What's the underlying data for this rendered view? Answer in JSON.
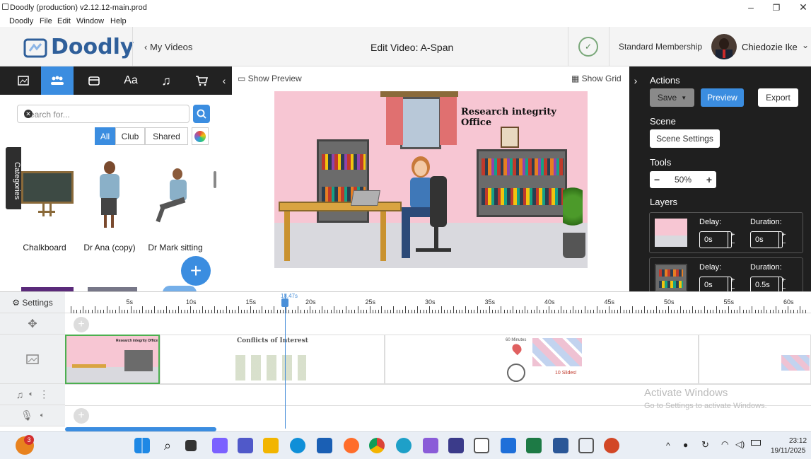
{
  "window": {
    "title": "Doodly (production) v2.12.12-main.prod",
    "menu": [
      "Doodly",
      "File",
      "Edit",
      "Window",
      "Help"
    ]
  },
  "header": {
    "logo_text": "Doodly",
    "back_link": "My Videos",
    "edit_title": "Edit Video: A-Span",
    "membership": "Standard Membership",
    "user_name": "Chiedozie Ike"
  },
  "tools": {
    "icons": [
      "image-icon",
      "characters-icon",
      "props-icon",
      "text-icon",
      "music-icon",
      "cart-icon",
      "collapse-icon"
    ]
  },
  "library": {
    "search_placeholder": "Search for...",
    "filters": [
      "All",
      "Club",
      "Shared"
    ],
    "categories_label": "Categories",
    "items": [
      "Chalkboard",
      "Dr Ana (copy)",
      "Dr Mark sitting"
    ]
  },
  "stage": {
    "show_preview": "Show Preview",
    "show_grid": "Show Grid",
    "scene_text": "Research integrity Office"
  },
  "actions": {
    "heading": "Actions",
    "save": "Save",
    "preview": "Preview",
    "export": "Export",
    "scene_heading": "Scene",
    "scene_settings": "Scene Settings",
    "tools_heading": "Tools",
    "zoom": "50%",
    "layers_heading": "Layers",
    "layers": [
      {
        "delay_label": "Delay:",
        "delay": "0s",
        "duration_label": "Duration:",
        "duration": "0s"
      },
      {
        "delay_label": "Delay:",
        "delay": "0s",
        "duration_label": "Duration:",
        "duration": "0.5s"
      }
    ]
  },
  "timeline": {
    "settings": "Settings",
    "playhead_time": "18.47s",
    "ruler_labels": [
      "5s",
      "10s",
      "15s",
      "20s",
      "25s",
      "30s",
      "35s",
      "40s",
      "45s",
      "50s",
      "55s",
      "60s"
    ],
    "scenes": [
      "Research integrity Office",
      "Conflicts of Interest",
      "60 Minutes",
      "10 Slides!"
    ]
  },
  "watermark": {
    "line1": "Activate Windows",
    "line2": "Go to Settings to activate Windows."
  },
  "taskbar": {
    "notification_count": "3",
    "time": "23:12",
    "date": "19/11/2025"
  },
  "colors": {
    "accent": "#4a90d9",
    "dark_panel": "#1f1f1f",
    "stage_bg": "#f7c6d3"
  }
}
